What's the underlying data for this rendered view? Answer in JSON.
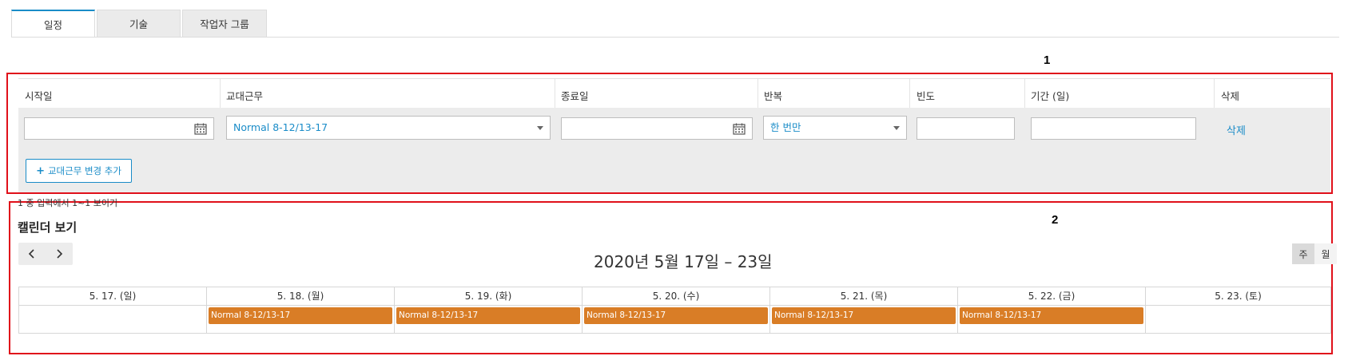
{
  "tabs": [
    {
      "label": "일정",
      "active": true
    },
    {
      "label": "기술",
      "active": false
    },
    {
      "label": "작업자 그룹",
      "active": false
    }
  ],
  "annotations": {
    "box1": "1",
    "box2": "2",
    "color": "#e0101a"
  },
  "form": {
    "headers": [
      "시작일",
      "교대근무",
      "종료일",
      "반복",
      "빈도",
      "기간 (일)",
      "삭제"
    ],
    "row": {
      "start_date": "",
      "shift": "Normal 8-12/13-17",
      "end_date": "",
      "repeat": "한 번만",
      "frequency": "",
      "duration": "",
      "delete_label": "삭제"
    },
    "add_button_label": "교대근무 변경 추가"
  },
  "count_text": "1 중 입력에서 1~1 보이기",
  "calendar": {
    "title": "캘린더 보기",
    "range": "2020년 5월 17일 – 23일",
    "view_week": "주",
    "view_month": "월",
    "active_view": "week",
    "days": [
      {
        "label": "5. 17. (일)",
        "event": ""
      },
      {
        "label": "5. 18. (월)",
        "event": "Normal 8-12/13-17"
      },
      {
        "label": "5. 19. (화)",
        "event": "Normal 8-12/13-17"
      },
      {
        "label": "5. 20. (수)",
        "event": "Normal 8-12/13-17"
      },
      {
        "label": "5. 21. (목)",
        "event": "Normal 8-12/13-17"
      },
      {
        "label": "5. 22. (금)",
        "event": "Normal 8-12/13-17"
      },
      {
        "label": "5. 23. (토)",
        "event": ""
      }
    ],
    "event_color": "#d97d26"
  },
  "colors": {
    "accent": "#1a8cc8"
  },
  "icons": [
    "calendar-icon",
    "chevron-left-icon",
    "chevron-right-icon",
    "caret-down-icon",
    "plus-icon"
  ]
}
